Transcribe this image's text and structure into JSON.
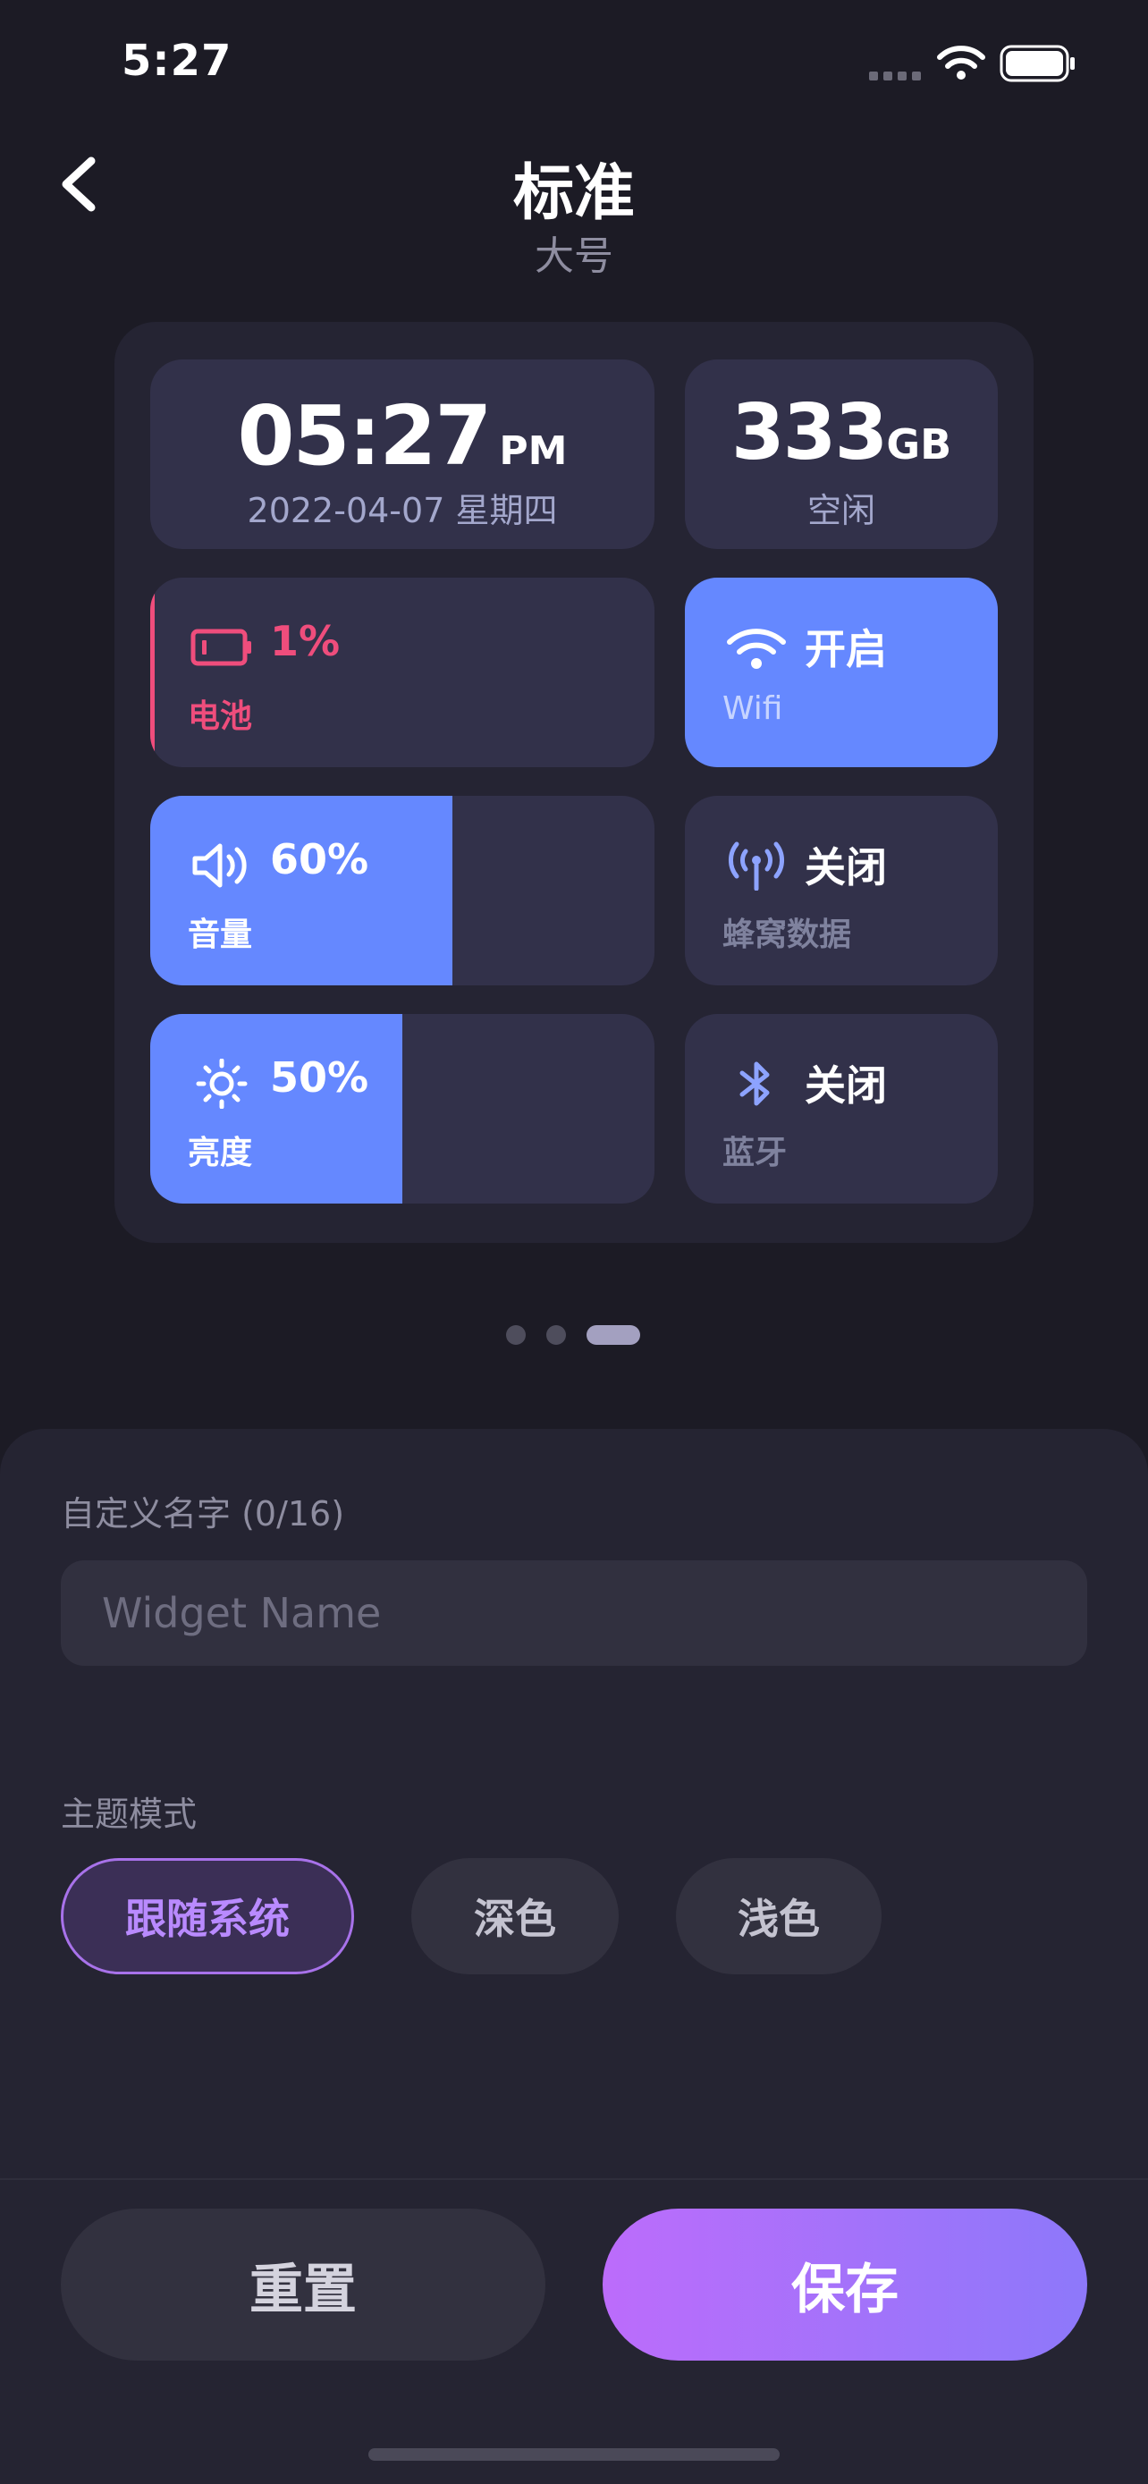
{
  "status_bar": {
    "time": "5:27"
  },
  "header": {
    "title": "标准",
    "subtitle": "大号"
  },
  "widget": {
    "clock": {
      "time": "05:27",
      "ampm": "PM",
      "date": "2022-04-07 星期四"
    },
    "storage": {
      "value": "333",
      "unit": "GB",
      "label": "空闲"
    },
    "battery": {
      "value": "1%",
      "label": "电池",
      "color": "#ef4d7c",
      "level": 0.01
    },
    "wifi": {
      "value": "开启",
      "label": "Wifi"
    },
    "volume": {
      "value": "60%",
      "label": "音量",
      "level": 0.6
    },
    "cellular": {
      "value": "关闭",
      "label": "蜂窝数据"
    },
    "brightness": {
      "value": "50%",
      "label": "亮度",
      "level": 0.5
    },
    "bluetooth": {
      "value": "关闭",
      "label": "蓝牙"
    },
    "accent_color": "#6588ff"
  },
  "pager": {
    "count": 3,
    "active_index": 2
  },
  "form": {
    "name_label": "自定义名字 (0/16)",
    "name_placeholder": "Widget Name",
    "name_value": "",
    "theme_label": "主题模式",
    "theme_options": [
      "跟随系统",
      "深色",
      "浅色"
    ],
    "theme_selected": "跟随系统"
  },
  "actions": {
    "reset_label": "重置",
    "save_label": "保存"
  },
  "colors": {
    "background": "#1c1b25",
    "selected_accent": "#a872ea",
    "save_gradient": [
      "#bc6cfb",
      "#8d78fa"
    ]
  }
}
